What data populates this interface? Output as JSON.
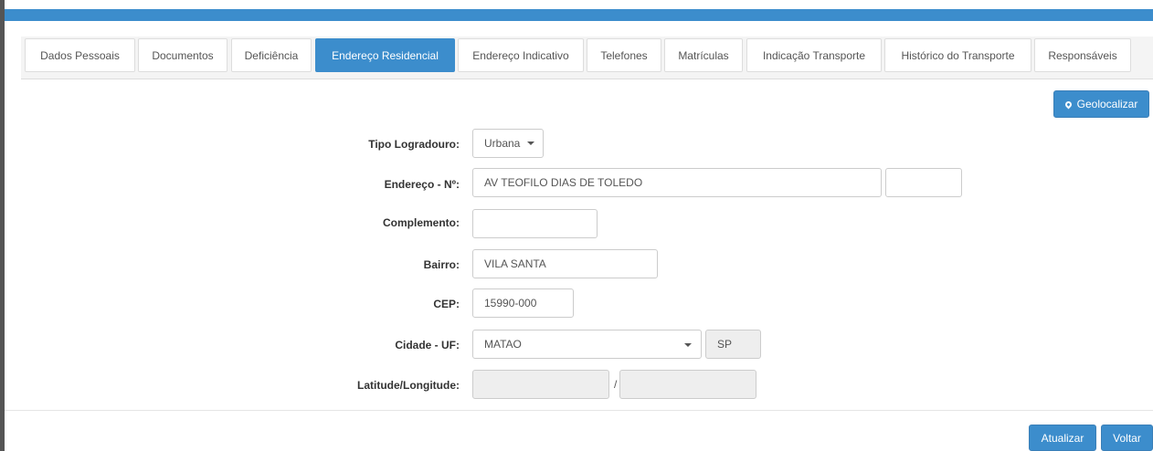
{
  "tabs": [
    {
      "label": "Dados Pessoais"
    },
    {
      "label": "Documentos"
    },
    {
      "label": "Deficiência"
    },
    {
      "label": "Endereço Residencial",
      "active": true
    },
    {
      "label": "Endereço Indicativo"
    },
    {
      "label": "Telefones"
    },
    {
      "label": "Matrículas"
    },
    {
      "label": "Indicação Transporte"
    },
    {
      "label": "Histórico do Transporte"
    },
    {
      "label": "Responsáveis"
    }
  ],
  "geolocate_label": "Geolocalizar",
  "form": {
    "tipo_logradouro": {
      "label": "Tipo Logradouro:",
      "value": "Urbana"
    },
    "endereco": {
      "label": "Endereço - Nº:",
      "value": "AV TEOFILO DIAS DE TOLEDO",
      "numero": ""
    },
    "complemento": {
      "label": "Complemento:",
      "value": ""
    },
    "bairro": {
      "label": "Bairro:",
      "value": "VILA SANTA"
    },
    "cep": {
      "label": "CEP:",
      "value": "15990-000"
    },
    "cidade_uf": {
      "label": "Cidade - UF:",
      "cidade": "MATAO",
      "uf": "SP"
    },
    "lat_long": {
      "label": "Latitude/Longitude:",
      "latitude": "",
      "separator": "/",
      "longitude": ""
    }
  },
  "actions": {
    "update_label": "Atualizar",
    "back_label": "Voltar"
  },
  "colors": {
    "primary": "#3c8dcc",
    "border": "#cccccc",
    "disabled": "#eeeeee"
  }
}
